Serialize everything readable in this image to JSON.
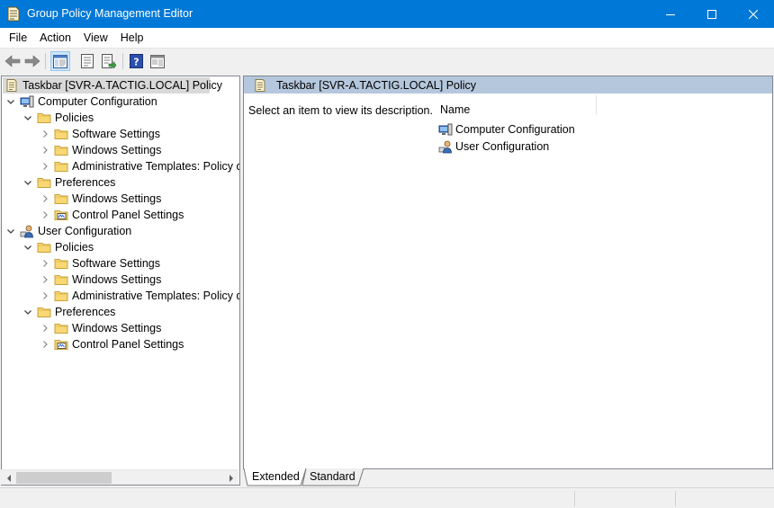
{
  "window": {
    "title": "Group Policy Management Editor",
    "controls": [
      "minimize",
      "maximize",
      "close"
    ]
  },
  "menu": {
    "items": [
      "File",
      "Action",
      "View",
      "Help"
    ]
  },
  "toolbar": {
    "buttons": [
      {
        "name": "back",
        "icon": "arrow-left-icon"
      },
      {
        "name": "forward",
        "icon": "arrow-right-icon"
      },
      {
        "name": "show-hide-console-tree",
        "icon": "console-tree-icon",
        "active": true
      },
      {
        "name": "properties",
        "icon": "properties-icon"
      },
      {
        "name": "export-list",
        "icon": "export-list-icon"
      },
      {
        "name": "help",
        "icon": "help-icon"
      },
      {
        "name": "show-hide-action-pane",
        "icon": "action-pane-icon"
      }
    ]
  },
  "tree": {
    "root": "Taskbar [SVR-A.TACTIG.LOCAL] Policy",
    "items": [
      {
        "label": "Computer Configuration",
        "icon": "computer-icon",
        "expanded": true
      },
      {
        "label": "Policies",
        "icon": "folder-icon",
        "expanded": true
      },
      {
        "label": "Software Settings",
        "icon": "folder-icon",
        "expanded": false
      },
      {
        "label": "Windows Settings",
        "icon": "folder-icon",
        "expanded": false
      },
      {
        "label": "Administrative Templates: Policy d",
        "icon": "folder-icon",
        "expanded": false
      },
      {
        "label": "Preferences",
        "icon": "folder-icon",
        "expanded": true
      },
      {
        "label": "Windows Settings",
        "icon": "folder-icon",
        "expanded": false
      },
      {
        "label": "Control Panel Settings",
        "icon": "control-panel-folder-icon",
        "expanded": false
      },
      {
        "label": "User Configuration",
        "icon": "user-icon",
        "expanded": true
      },
      {
        "label": "Policies",
        "icon": "folder-icon",
        "expanded": true
      },
      {
        "label": "Software Settings",
        "icon": "folder-icon",
        "expanded": false
      },
      {
        "label": "Windows Settings",
        "icon": "folder-icon",
        "expanded": false
      },
      {
        "label": "Administrative Templates: Policy d",
        "icon": "folder-icon",
        "expanded": false
      },
      {
        "label": "Preferences",
        "icon": "folder-icon",
        "expanded": true
      },
      {
        "label": "Windows Settings",
        "icon": "folder-icon",
        "expanded": false
      },
      {
        "label": "Control Panel Settings",
        "icon": "control-panel-folder-icon",
        "expanded": false
      }
    ]
  },
  "details": {
    "header": "Taskbar [SVR-A.TACTIG.LOCAL] Policy",
    "description": "Select an item to view its description.",
    "column_name": "Name",
    "items": [
      {
        "label": "Computer Configuration",
        "icon": "computer-icon"
      },
      {
        "label": "User Configuration",
        "icon": "user-icon"
      }
    ]
  },
  "tabs": {
    "extended": "Extended",
    "standard": "Standard",
    "active": "Extended"
  },
  "colors": {
    "titlebar": "#0078d7",
    "details_header": "#b5c7dc",
    "tree_selection": "#d9d9d9"
  }
}
